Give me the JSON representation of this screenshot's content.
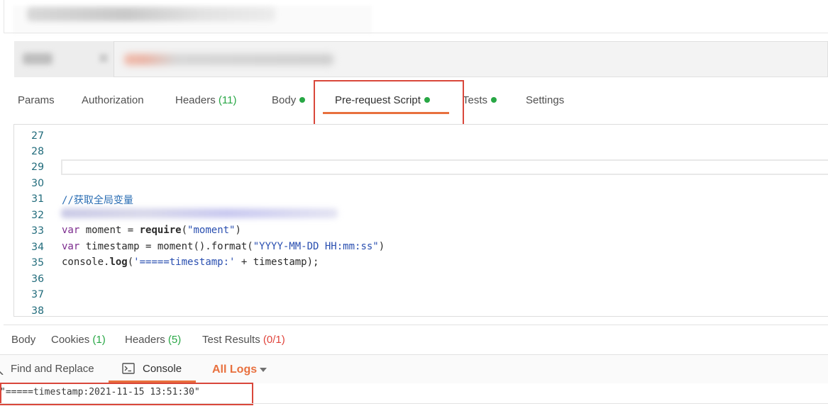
{
  "request_tabs": {
    "params": "Params",
    "authorization": "Authorization",
    "headers": "Headers",
    "headers_count": "(11)",
    "body": "Body",
    "prerequest": "Pre-request Script",
    "tests": "Tests",
    "settings": "Settings"
  },
  "editor": {
    "lines": [
      {
        "n": "27",
        "code": ""
      },
      {
        "n": "28",
        "code": ""
      },
      {
        "n": "29",
        "code": ""
      },
      {
        "n": "30",
        "code": ""
      },
      {
        "n": "31",
        "comment": "//获取全局变量"
      },
      {
        "n": "32",
        "code": ""
      },
      {
        "n": "33",
        "kw": "var",
        "rest1": " moment = ",
        "call": "require",
        "rest2": "(",
        "str": "\"moment\"",
        "rest3": ")"
      },
      {
        "n": "34",
        "kw": "var",
        "rest1": " timestamp = moment().format(",
        "str": "\"YYYY-MM-DD HH:mm:ss\"",
        "rest3": ")"
      },
      {
        "n": "35",
        "pre": "console.",
        "call": "log",
        "rest1": "(",
        "str": "'=====timestamp:'",
        "rest3": " + timestamp);"
      },
      {
        "n": "36",
        "code": ""
      },
      {
        "n": "37",
        "code": ""
      },
      {
        "n": "38",
        "code": ""
      }
    ]
  },
  "response_tabs": {
    "body": "Body",
    "cookies": "Cookies",
    "cookies_count": "(1)",
    "headers": "Headers",
    "headers_count": "(5)",
    "test_results": "Test Results",
    "test_results_count": "(0/1)"
  },
  "console_bar": {
    "find_replace": "Find and Replace",
    "console": "Console",
    "all_logs": "All Logs"
  },
  "console_output": "\"=====timestamp:2021-11-15 13:51:30\"",
  "icons": {
    "console": "terminal-icon",
    "search": "search-icon",
    "dropdown": "chevron-down-icon"
  },
  "colors": {
    "accent": "#e8703e",
    "highlight_box": "#d9473b",
    "success": "#28a745",
    "fail": "#e0433b"
  }
}
